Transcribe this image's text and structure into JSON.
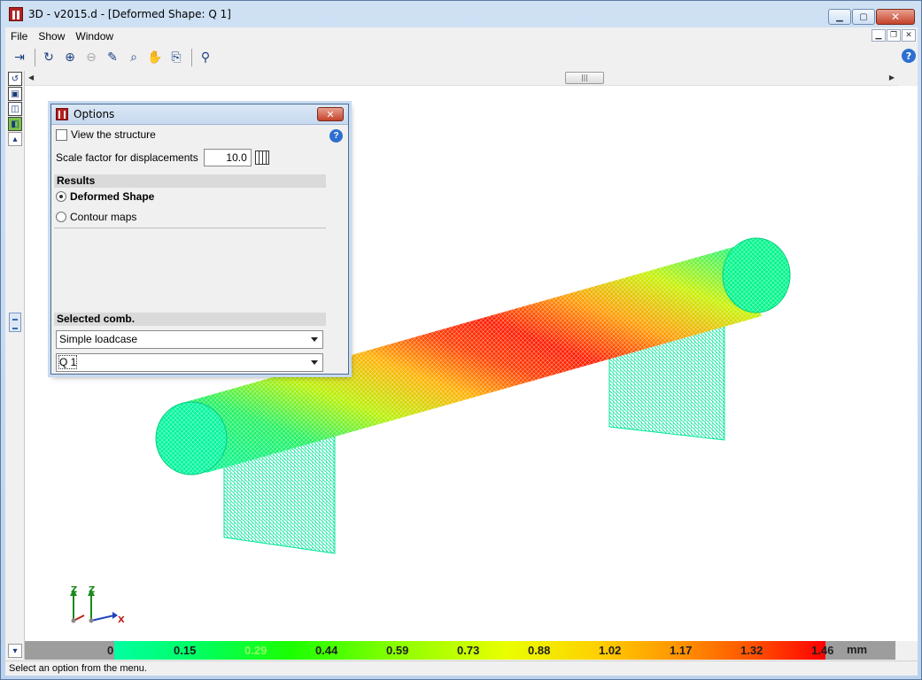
{
  "window": {
    "title": "3D - v2015.d - [Deformed Shape: Q 1]"
  },
  "menu": {
    "items": [
      {
        "label": "File",
        "key": "F"
      },
      {
        "label": "Show",
        "key": "S"
      },
      {
        "label": "Window",
        "key": "W"
      }
    ]
  },
  "toolbar": {
    "icons": [
      "exit-icon",
      "rotate-icon",
      "zoom-window-icon",
      "zoom-out-icon",
      "pen-icon",
      "zoom-extents-icon",
      "pan-hand-icon",
      "export-icon",
      "binoculars-icon"
    ]
  },
  "options_dialog": {
    "title": "Options",
    "view_structure_label": "View the structure",
    "view_structure_checked": false,
    "scale_label": "Scale factor for displacements",
    "scale_value": "10.0",
    "results_header": "Results",
    "deformed_label": "Deformed Shape",
    "contour_label": "Contour maps",
    "selected_result": "Deformed Shape",
    "comb_header": "Selected comb.",
    "comb_type": "Simple loadcase",
    "comb_value": "Q 1"
  },
  "legend": {
    "values": [
      "0",
      "0.15",
      "0.29",
      "0.44",
      "0.59",
      "0.73",
      "0.88",
      "1.02",
      "1.17",
      "1.32",
      "1.46"
    ],
    "unit": "mm"
  },
  "axes": {
    "z_label": "Z",
    "x_label": "X"
  },
  "status": {
    "text": "Select an option from the menu."
  }
}
